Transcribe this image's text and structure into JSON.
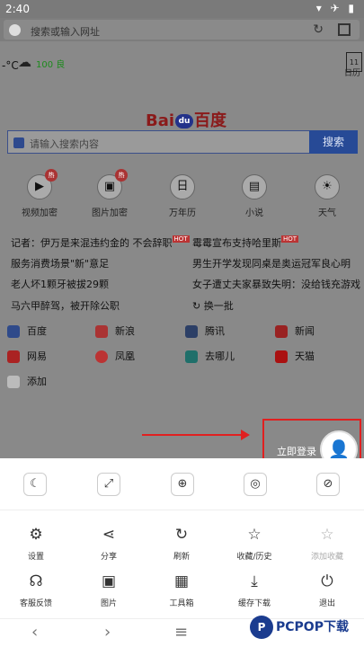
{
  "status": {
    "time": "2:40",
    "icons": "▾ ✈ ▮"
  },
  "address": {
    "placeholder": "搜索或输入网址"
  },
  "weather": {
    "temp": "-°C",
    "air": "100 良"
  },
  "calendar": {
    "day": "11",
    "label": "日历"
  },
  "brand": {
    "pre": "Bai",
    "paw": "du",
    "post": "百度"
  },
  "search": {
    "placeholder": "请输入搜索内容",
    "button": "搜索"
  },
  "quick": [
    {
      "label": "视频加密",
      "badge": "热",
      "icon": "▶"
    },
    {
      "label": "图片加密",
      "badge": "热",
      "icon": "▣"
    },
    {
      "label": "万年历",
      "icon": "日"
    },
    {
      "label": "小说",
      "icon": "▤"
    },
    {
      "label": "天气",
      "icon": "☀"
    }
  ],
  "news": [
    "记者：伊万是来混违约金的 不会辞职",
    "霉霉宣布支持哈里斯",
    "服务消费场景\"新\"意足",
    "男生开学发现同桌是奥运冠军良心明",
    "老人坏1颗牙被拔29颗",
    "女子遭丈夫家暴致失明：没给钱充游戏",
    "马六甲醉驾，被开除公职",
    "换一批"
  ],
  "hot_tag": "HOT",
  "sites": [
    "百度",
    "新浪",
    "腾讯",
    "新闻",
    "网易",
    "凤凰",
    "去哪儿",
    "天猫",
    "添加"
  ],
  "login": {
    "label": "立即登录"
  },
  "menu": {
    "row1": [
      "设置",
      "分享",
      "刷新",
      "收藏/历史",
      "添加收藏"
    ],
    "row2": [
      "客服反馈",
      "图片",
      "工具箱",
      "缓存下载",
      "退出"
    ]
  },
  "watermark": {
    "logo": "P",
    "text": "PCPOP下载"
  },
  "colors": {
    "accent": "#274a96",
    "annotation": "#e02020"
  }
}
